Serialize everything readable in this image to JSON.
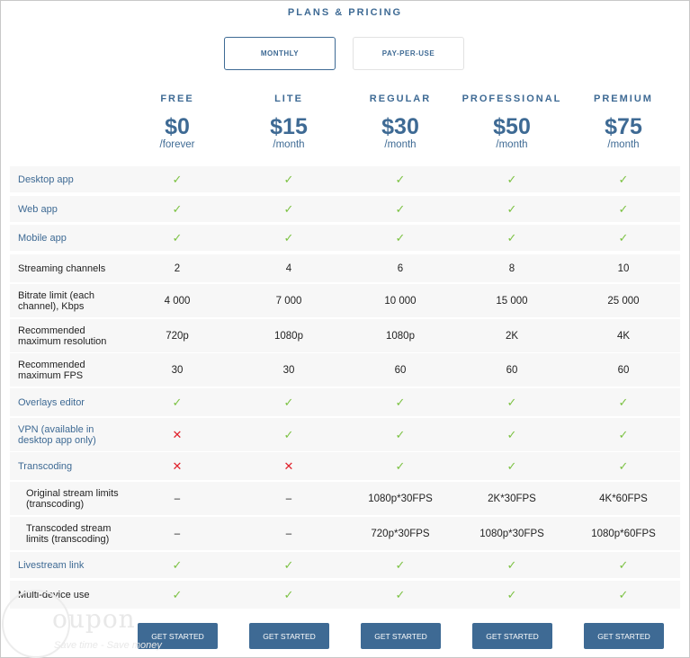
{
  "page": {
    "title": "PLANS & PRICING"
  },
  "billing_toggle": {
    "monthly": "MONTHLY",
    "pay_per_use": "PAY-PER-USE"
  },
  "plans": [
    {
      "name": "FREE",
      "price": "$0",
      "period": "/forever"
    },
    {
      "name": "LITE",
      "price": "$15",
      "period": "/month"
    },
    {
      "name": "REGULAR",
      "price": "$30",
      "period": "/month"
    },
    {
      "name": "PROFESSIONAL",
      "price": "$50",
      "period": "/month"
    },
    {
      "name": "PREMIUM",
      "price": "$75",
      "period": "/month"
    }
  ],
  "features": [
    {
      "label": "Desktop app",
      "style": "blue",
      "values": [
        "check",
        "check",
        "check",
        "check",
        "check"
      ]
    },
    {
      "label": "Web app",
      "style": "blue",
      "values": [
        "check",
        "check",
        "check",
        "check",
        "check"
      ]
    },
    {
      "label": "Mobile app",
      "style": "blue",
      "values": [
        "check",
        "check",
        "check",
        "check",
        "check"
      ]
    },
    {
      "label": "Streaming channels",
      "style": "dark",
      "values": [
        "2",
        "4",
        "6",
        "8",
        "10"
      ]
    },
    {
      "label": "Bitrate limit (each channel), Kbps",
      "style": "dark",
      "values": [
        "4 000",
        "7 000",
        "10 000",
        "15 000",
        "25 000"
      ]
    },
    {
      "label": "Recommended maximum resolution",
      "style": "dark",
      "values": [
        "720p",
        "1080p",
        "1080p",
        "2K",
        "4K"
      ]
    },
    {
      "label": "Recommended maximum FPS",
      "style": "dark",
      "values": [
        "30",
        "30",
        "60",
        "60",
        "60"
      ]
    },
    {
      "label": "Overlays editor",
      "style": "blue",
      "values": [
        "check",
        "check",
        "check",
        "check",
        "check"
      ]
    },
    {
      "label": "VPN (available in desktop app only)",
      "style": "blue",
      "values": [
        "cross",
        "check",
        "check",
        "check",
        "check"
      ]
    },
    {
      "label": "Transcoding",
      "style": "blue",
      "values": [
        "cross",
        "cross",
        "check",
        "check",
        "check"
      ]
    },
    {
      "label": "Original stream limits (transcoding)",
      "style": "indent",
      "values": [
        "–",
        "–",
        "1080p*30FPS",
        "2K*30FPS",
        "4K*60FPS"
      ]
    },
    {
      "label": "Transcoded stream limits (transcoding)",
      "style": "indent",
      "values": [
        "–",
        "–",
        "720p*30FPS",
        "1080p*30FPS",
        "1080p*60FPS"
      ]
    },
    {
      "label": "Livestream link",
      "style": "blue",
      "values": [
        "check",
        "check",
        "check",
        "check",
        "check"
      ]
    },
    {
      "label": "Multi-device use",
      "style": "dark",
      "values": [
        "check",
        "check",
        "check",
        "check",
        "check"
      ]
    }
  ],
  "cta": {
    "label": "GET STARTED"
  },
  "icons": {
    "check": "check-icon",
    "cross": "cross-icon"
  },
  "colors": {
    "accent": "#3e6a94",
    "check": "#7cc243",
    "cross": "#e0202a",
    "row_bg": "#f7f7f7"
  },
  "watermark": {
    "text": "oupon",
    "subtext": "Save time - Save money"
  }
}
